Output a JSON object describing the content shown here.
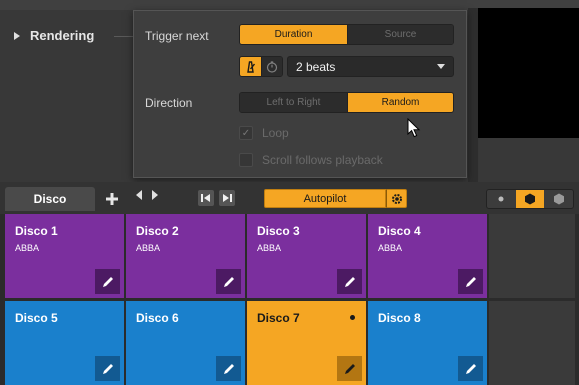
{
  "section": {
    "title": "Rendering"
  },
  "popup": {
    "trigger_label": "Trigger next",
    "trigger_options": [
      "Duration",
      "Source"
    ],
    "trigger_selected": "Duration",
    "beats_value": "2 beats",
    "direction_label": "Direction",
    "direction_options": [
      "Left to Right",
      "Random"
    ],
    "direction_selected": "Random",
    "loop_label": "Loop",
    "scroll_label": "Scroll follows playback"
  },
  "toolbar": {
    "tab_label": "Disco",
    "autopilot_label": "Autopilot"
  },
  "grid": {
    "items": [
      {
        "title": "Disco 1",
        "artist": "ABBA",
        "color": "#7b2f9e"
      },
      {
        "title": "Disco 2",
        "artist": "ABBA",
        "color": "#7b2f9e"
      },
      {
        "title": "Disco 3",
        "artist": "ABBA",
        "color": "#7b2f9e"
      },
      {
        "title": "Disco 4",
        "artist": "ABBA",
        "color": "#7b2f9e"
      },
      {
        "title": "Disco 5",
        "artist": "",
        "color": "#1a80cc"
      },
      {
        "title": "Disco 6",
        "artist": "",
        "color": "#1a80cc"
      },
      {
        "title": "Disco 7",
        "artist": "",
        "color": "#f5a623"
      },
      {
        "title": "Disco 8",
        "artist": "",
        "color": "#1a80cc"
      }
    ]
  },
  "colors": {
    "accent": "#f5a623",
    "purple": "#7b2f9e",
    "blue": "#1a80cc"
  }
}
